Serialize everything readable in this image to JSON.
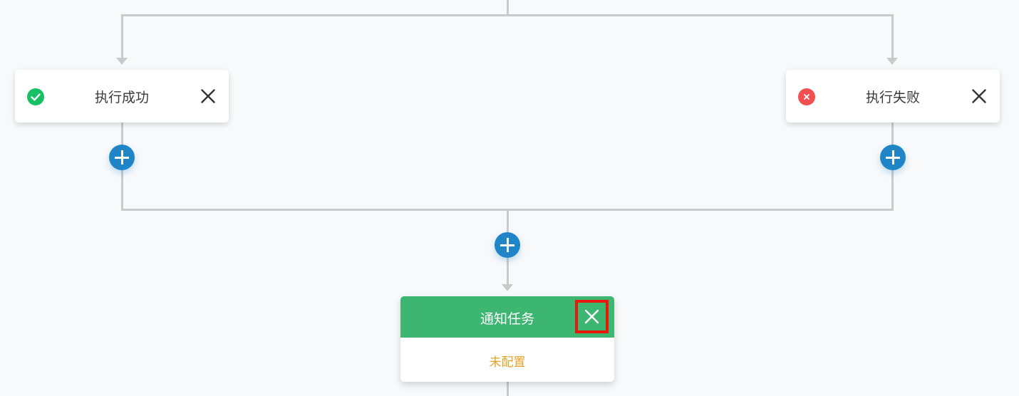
{
  "nodes": {
    "success": {
      "title": "执行成功",
      "status": "success",
      "status_color": "#18c065",
      "icon": "check-circle-icon"
    },
    "failure": {
      "title": "执行失败",
      "status": "failure",
      "status_color": "#f05050",
      "icon": "error-circle-icon"
    },
    "notify": {
      "title": "通知任务",
      "status_text": "未配置",
      "header_color": "#3db672",
      "status_text_color": "#e0a32a"
    }
  },
  "colors": {
    "accent": "#1f85c7",
    "connector": "#c8cacd",
    "close_highlight": "#e8180c",
    "background": "#f8f9fb"
  }
}
